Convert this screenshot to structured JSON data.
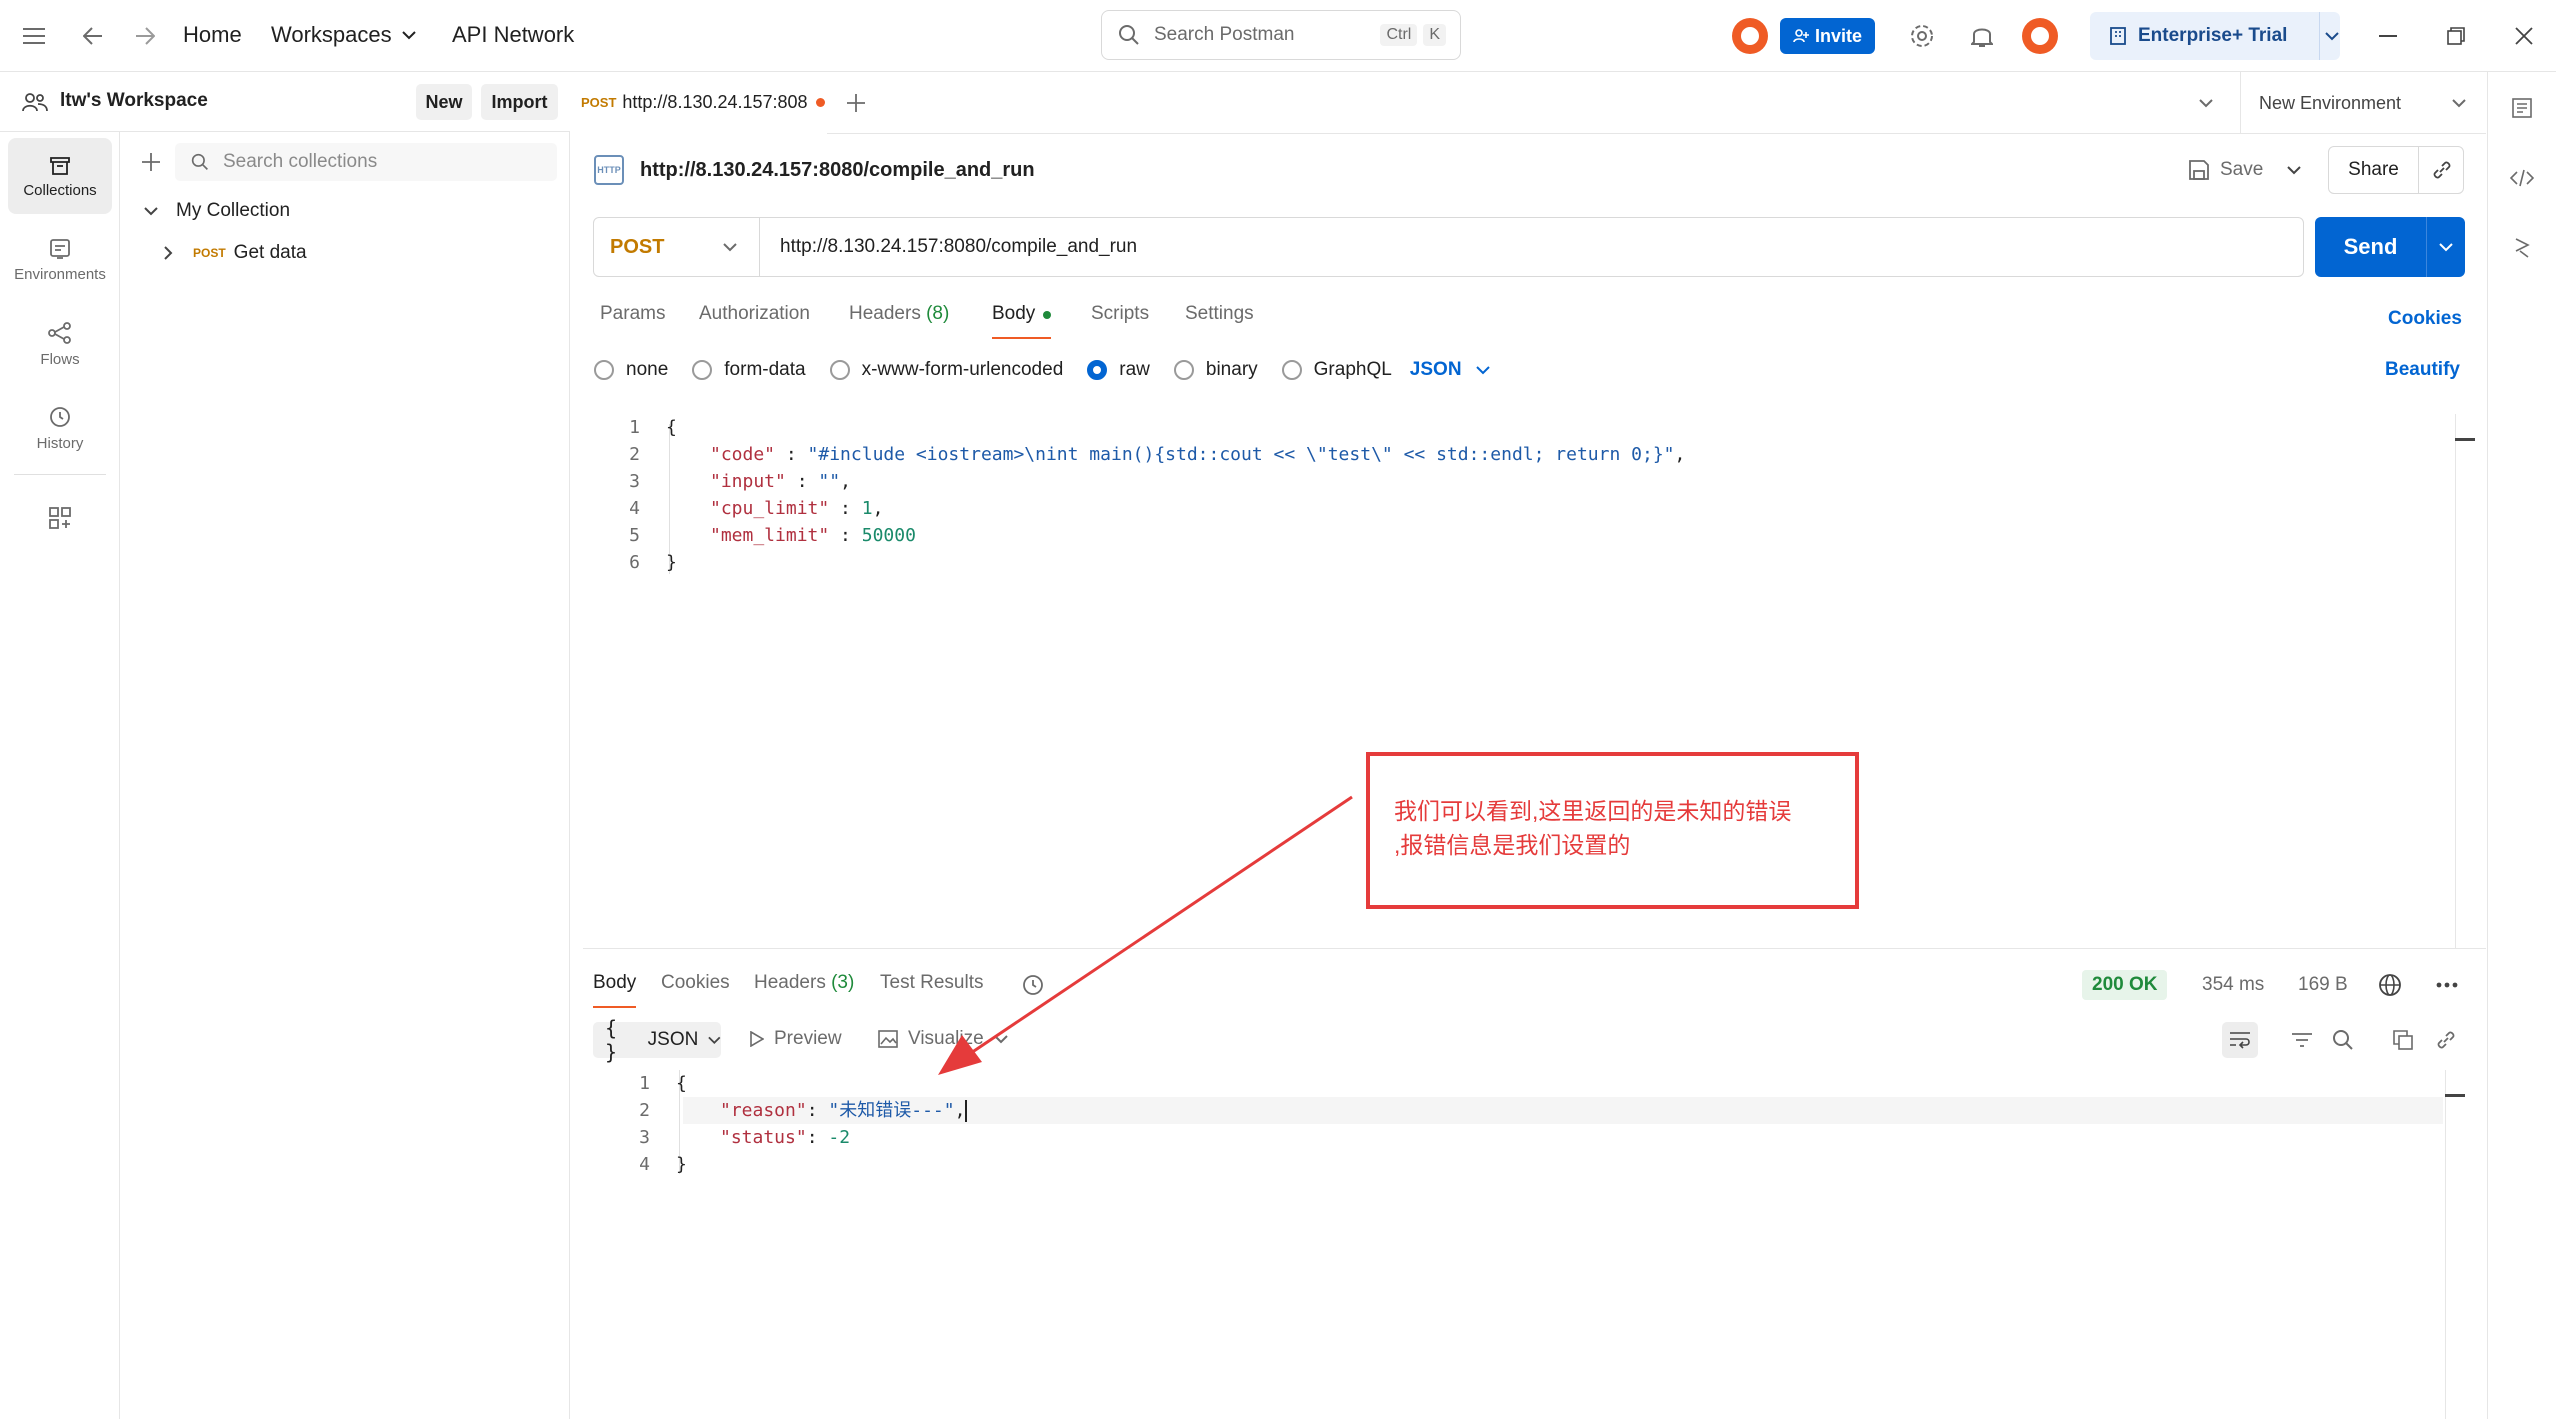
{
  "topbar": {
    "home": "Home",
    "workspaces": "Workspaces",
    "api_network": "API Network",
    "search_placeholder": "Search Postman",
    "search_kbd1": "Ctrl",
    "search_kbd2": "K",
    "invite": "Invite",
    "enterprise": "Enterprise+ Trial"
  },
  "rail": {
    "items": [
      {
        "label": "Collections",
        "icon": "collections-icon"
      },
      {
        "label": "Environments",
        "icon": "environments-icon"
      },
      {
        "label": "Flows",
        "icon": "flows-icon"
      },
      {
        "label": "History",
        "icon": "history-icon"
      }
    ]
  },
  "sidebar": {
    "workspace_name": "ltw's Workspace",
    "new_btn": "New",
    "import_btn": "Import",
    "search_placeholder": "Search collections",
    "collection_name": "My Collection",
    "request_method": "POST",
    "request_name": "Get data"
  },
  "tabbar": {
    "tab_method": "POST",
    "tab_title": "http://8.130.24.157:808",
    "environment": "New Environment"
  },
  "request": {
    "title": "http://8.130.24.157:8080/compile_and_run",
    "http_badge": "HTTP",
    "save": "Save",
    "share": "Share",
    "method": "POST",
    "url": "http://8.130.24.157:8080/compile_and_run",
    "send": "Send",
    "tabs": {
      "params": "Params",
      "authorization": "Authorization",
      "headers": "Headers",
      "headers_count": "(8)",
      "body": "Body",
      "scripts": "Scripts",
      "settings": "Settings"
    },
    "cookies": "Cookies",
    "beautify": "Beautify",
    "body_modes": {
      "none": "none",
      "form_data": "form-data",
      "urlencoded": "x-www-form-urlencoded",
      "raw": "raw",
      "binary": "binary",
      "graphql": "GraphQL",
      "format": "JSON"
    },
    "body_lines": {
      "l1": "{",
      "code_key": "\"code\"",
      "code_val": "\"#include <iostream>\\nint main(){std::cout << \\\"test\\\" << std::endl; return 0;}\"",
      "input_key": "\"input\"",
      "input_val": "\"\"",
      "cpu_key": "\"cpu_limit\"",
      "cpu_val": "1",
      "mem_key": "\"mem_limit\"",
      "mem_val": "50000",
      "l6": "}"
    }
  },
  "response": {
    "tabs": {
      "body": "Body",
      "cookies": "Cookies",
      "headers": "Headers",
      "headers_count": "(3)",
      "tests": "Test Results"
    },
    "status": "200 OK",
    "time": "354 ms",
    "size": "169 B",
    "format": "JSON",
    "preview": "Preview",
    "visualize": "Visualize",
    "body_lines": {
      "l1": "{",
      "reason_key": "\"reason\"",
      "reason_val": "\"未知错误---\"",
      "status_key": "\"status\"",
      "status_val": "-2",
      "l4": "}"
    }
  },
  "annotation": {
    "line1": "我们可以看到,这里返回的是未知的错误",
    "line2": ",报错信息是我们设置的"
  },
  "colors": {
    "accent_orange": "#ef5b25",
    "primary_blue": "#0265d2",
    "annotation_red": "#e53b3b"
  }
}
